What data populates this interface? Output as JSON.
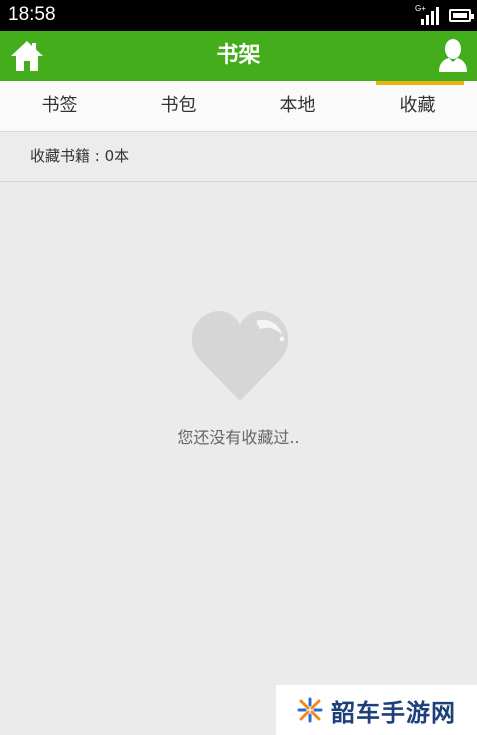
{
  "status_bar": {
    "time": "18:58",
    "network": "G+"
  },
  "app_bar": {
    "title": "书架",
    "home_icon": "home-icon",
    "user_icon": "user-icon",
    "color": "#43ad1b"
  },
  "tabs": [
    {
      "label": "书签",
      "active": false
    },
    {
      "label": "书包",
      "active": false
    },
    {
      "label": "本地",
      "active": false
    },
    {
      "label": "收藏",
      "active": true
    }
  ],
  "accent_color": "#e8b410",
  "count_row": {
    "label": "收藏书籍 : 0本"
  },
  "empty_state": {
    "icon": "heart-icon",
    "message": "您还没有收藏过.."
  },
  "watermark": {
    "text": "韶车手游网"
  }
}
